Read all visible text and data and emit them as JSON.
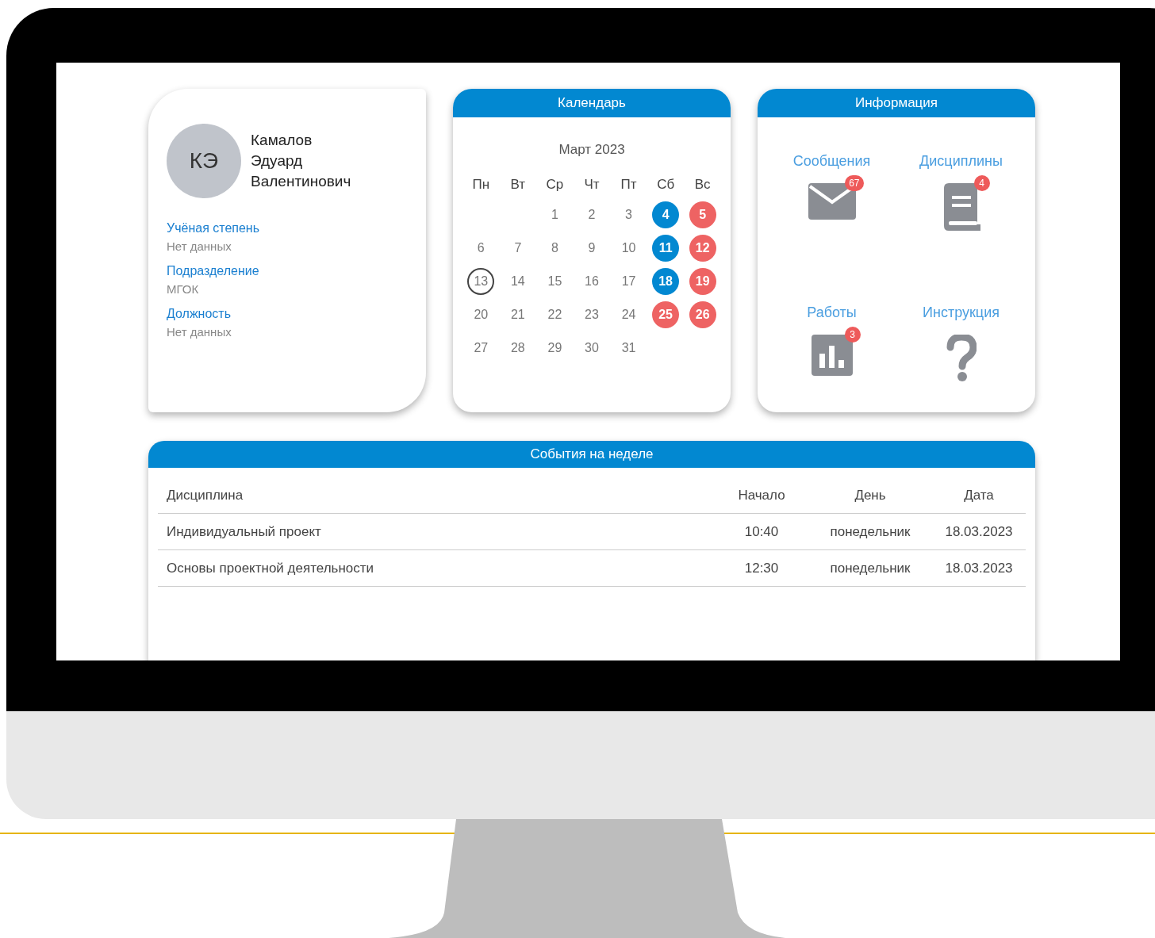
{
  "profile": {
    "initials": "КЭ",
    "name_lines": [
      "Камалов",
      "Эдуард",
      "Валентинович"
    ],
    "fields": [
      {
        "label": "Учёная степень",
        "value": "Нет данных"
      },
      {
        "label": "Подразделение",
        "value": "МГОК"
      },
      {
        "label": "Должность",
        "value": "Нет данных"
      }
    ]
  },
  "calendar": {
    "title": "Календарь",
    "month": "Март 2023",
    "weekdays": [
      "Пн",
      "Вт",
      "Ср",
      "Чт",
      "Пт",
      "Сб",
      "Вс"
    ],
    "weeks": [
      [
        {
          "day": "1",
          "today": false
        },
        {
          "day": "2",
          "today": false
        },
        {
          "day": "3",
          "today": false
        },
        {
          "day": "4",
          "today": false,
          "color": "#0288d1"
        },
        {
          "day": "5",
          "today": false,
          "color": "#ee6363"
        }
      ],
      [
        {
          "day": "6",
          "today": false
        },
        {
          "day": "7",
          "today": false
        },
        {
          "day": "8",
          "today": false
        },
        {
          "day": "9",
          "today": false
        },
        {
          "day": "10",
          "today": false
        },
        {
          "day": "11",
          "today": false,
          "color": "#0288d1"
        },
        {
          "day": "12",
          "today": false,
          "color": "#ee6363"
        }
      ],
      [
        {
          "day": "13",
          "today": true
        },
        {
          "day": "14",
          "today": false
        },
        {
          "day": "15",
          "today": false
        },
        {
          "day": "16",
          "today": false
        },
        {
          "day": "17",
          "today": false
        },
        {
          "day": "18",
          "today": false,
          "color": "#0288d1"
        },
        {
          "day": "19",
          "today": false,
          "color": "#ee6363"
        }
      ],
      [
        {
          "day": "20",
          "today": false
        },
        {
          "day": "21",
          "today": false
        },
        {
          "day": "22",
          "today": false
        },
        {
          "day": "23",
          "today": false
        },
        {
          "day": "24",
          "today": false
        },
        {
          "day": "25",
          "today": false,
          "color": "#ee6363"
        },
        {
          "day": "26",
          "today": false,
          "color": "#ee6363"
        }
      ],
      [
        {
          "day": "27",
          "today": false
        },
        {
          "day": "28",
          "today": false
        },
        {
          "day": "29",
          "today": false
        },
        {
          "day": "30",
          "today": false
        },
        {
          "day": "31",
          "today": false
        }
      ]
    ]
  },
  "info": {
    "title": "Информация",
    "tiles": [
      {
        "kind": "mail",
        "label": "Сообщения",
        "badge": "67"
      },
      {
        "kind": "book",
        "label": "Дисциплины",
        "badge": "4"
      },
      {
        "kind": "chart",
        "label": "Работы",
        "badge": "3"
      },
      {
        "kind": "question",
        "label": "Инструкция"
      }
    ]
  },
  "events": {
    "title": "События на неделе",
    "columns": [
      "Дисциплина",
      "Начало",
      "День",
      "Дата"
    ],
    "rows": [
      [
        "Индивидуальный проект",
        "10:40",
        "понедельник",
        "18.03.2023"
      ],
      [
        "Основы проектной деятельности",
        "12:30",
        "понедельник",
        "18.03.2023"
      ]
    ]
  }
}
